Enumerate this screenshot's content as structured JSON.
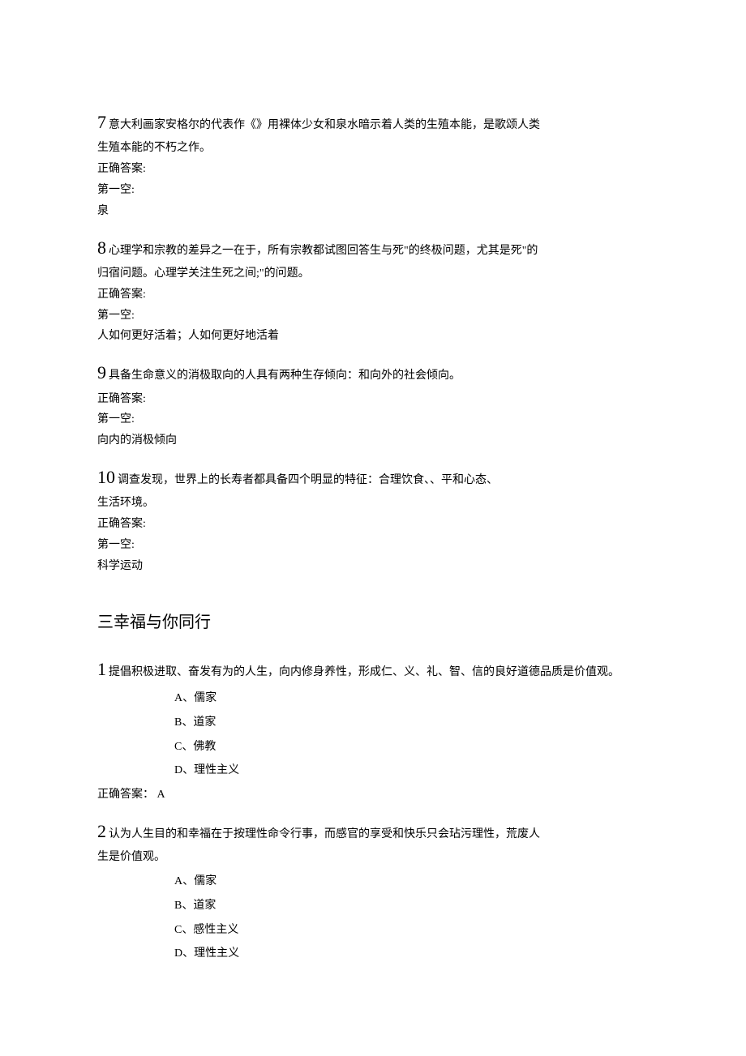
{
  "q7": {
    "num": "7",
    "text1": "意大利画家安格尔的代表作《》用裸体少女和泉水暗示着人类的生殖本能，是歌颂人类",
    "text2": "生殖本能的不朽之作。",
    "ans_label": "正确答案:",
    "blank_label": "第一空:",
    "ans": "泉"
  },
  "q8": {
    "num": "8",
    "text1": "心理学和宗教的差异之一在于，所有宗教都试图回答生与死\"的终极问题，尤其是死\"的",
    "text2": "归宿问题。心理学关注生死之间;\"的问题。",
    "ans_label": "正确答案:",
    "blank_label": "第一空:",
    "ans": "人如何更好活着；人如何更好地活着"
  },
  "q9": {
    "num": "9",
    "text1": "具备生命意义的消极取向的人具有两种生存倾向：和向外的社会倾向。",
    "ans_label": "正确答案:",
    "blank_label": "第一空:",
    "ans": "向内的消极倾向"
  },
  "q10": {
    "num": "10",
    "text1": "调查发现，世界上的长寿者都具备四个明显的特征：合理饮食、、平和心态、",
    "text2": "生活环境。",
    "ans_label": "正确答案:",
    "blank_label": "第一空:",
    "ans": "科学运动"
  },
  "section": {
    "title": "三幸福与你同行"
  },
  "s1": {
    "num": "1",
    "text1": "提倡积极进取、奋发有为的人生，向内修身养性，形成仁、义、礼、智、信的良好道德品质是价值观。",
    "optA": "A、儒家",
    "optB": "B、道家",
    "optC": "C、佛教",
    "optD": "D、理性主义",
    "ans": "正确答案： A"
  },
  "s2": {
    "num": "2",
    "text1": "认为人生目的和幸福在于按理性命令行事，而感官的享受和快乐只会玷污理性，荒废人",
    "text2": "生是价值观。",
    "optA": "A、儒家",
    "optB": "B、道家",
    "optC": "C、感性主义",
    "optD": "D、理性主义"
  }
}
